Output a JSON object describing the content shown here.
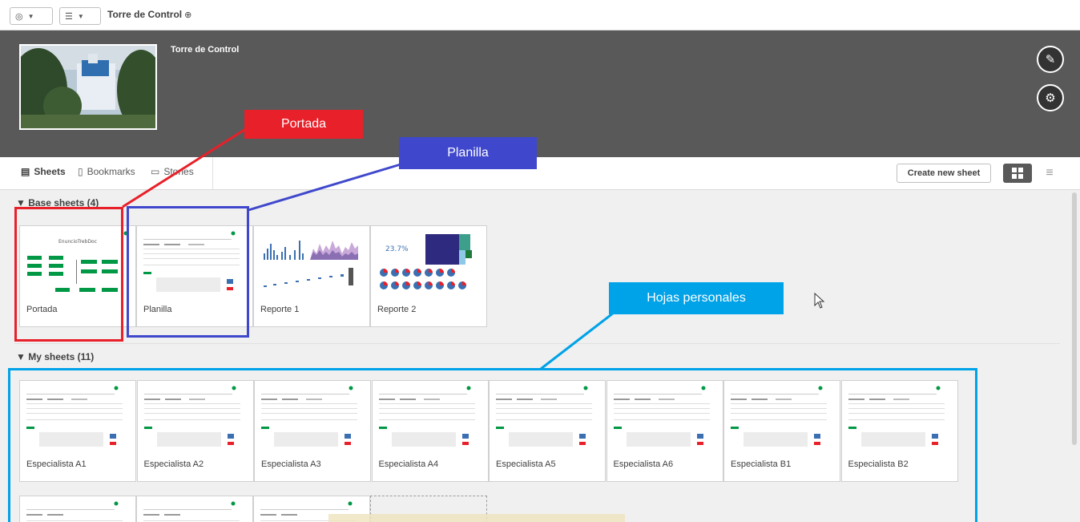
{
  "topbar": {
    "app_title": "Torre de Control",
    "globe_glyph": "⊕",
    "nav_icon": "compass-icon",
    "list_icon": "list-icon"
  },
  "hero": {
    "title": "Torre de Control"
  },
  "tabs": [
    {
      "label": "Sheets",
      "icon": "sheets-icon",
      "active": true
    },
    {
      "label": "Bookmarks",
      "icon": "bookmark-icon",
      "active": false
    },
    {
      "label": "Stories",
      "icon": "stories-icon",
      "active": false
    }
  ],
  "toolbar": {
    "create_label": "Create new sheet"
  },
  "base_sheets": {
    "heading": "▼ Base sheets (4)",
    "items": [
      {
        "label": "Portada",
        "preview": "portada"
      },
      {
        "label": "Planilla",
        "preview": "table"
      },
      {
        "label": "Reporte 1",
        "preview": "bars"
      },
      {
        "label": "Reporte 2",
        "preview": "pies"
      }
    ]
  },
  "my_sheets": {
    "heading": "▼ My sheets (11)",
    "items": [
      {
        "label": "Especialista A1"
      },
      {
        "label": "Especialista A2"
      },
      {
        "label": "Especialista A3"
      },
      {
        "label": "Especialista A4"
      },
      {
        "label": "Especialista A5"
      },
      {
        "label": "Especialista A6"
      },
      {
        "label": "Especialista B1"
      },
      {
        "label": "Especialista B2"
      }
    ]
  },
  "annotations": {
    "portada": "Portada",
    "planilla": "Planilla",
    "hojas": "Hojas personales",
    "colors": {
      "red": "#e8202a",
      "blue": "#3f48cc",
      "cyan": "#00a2e8"
    }
  },
  "colors": {
    "hero_bg": "#595959",
    "accent_green": "#009845"
  }
}
